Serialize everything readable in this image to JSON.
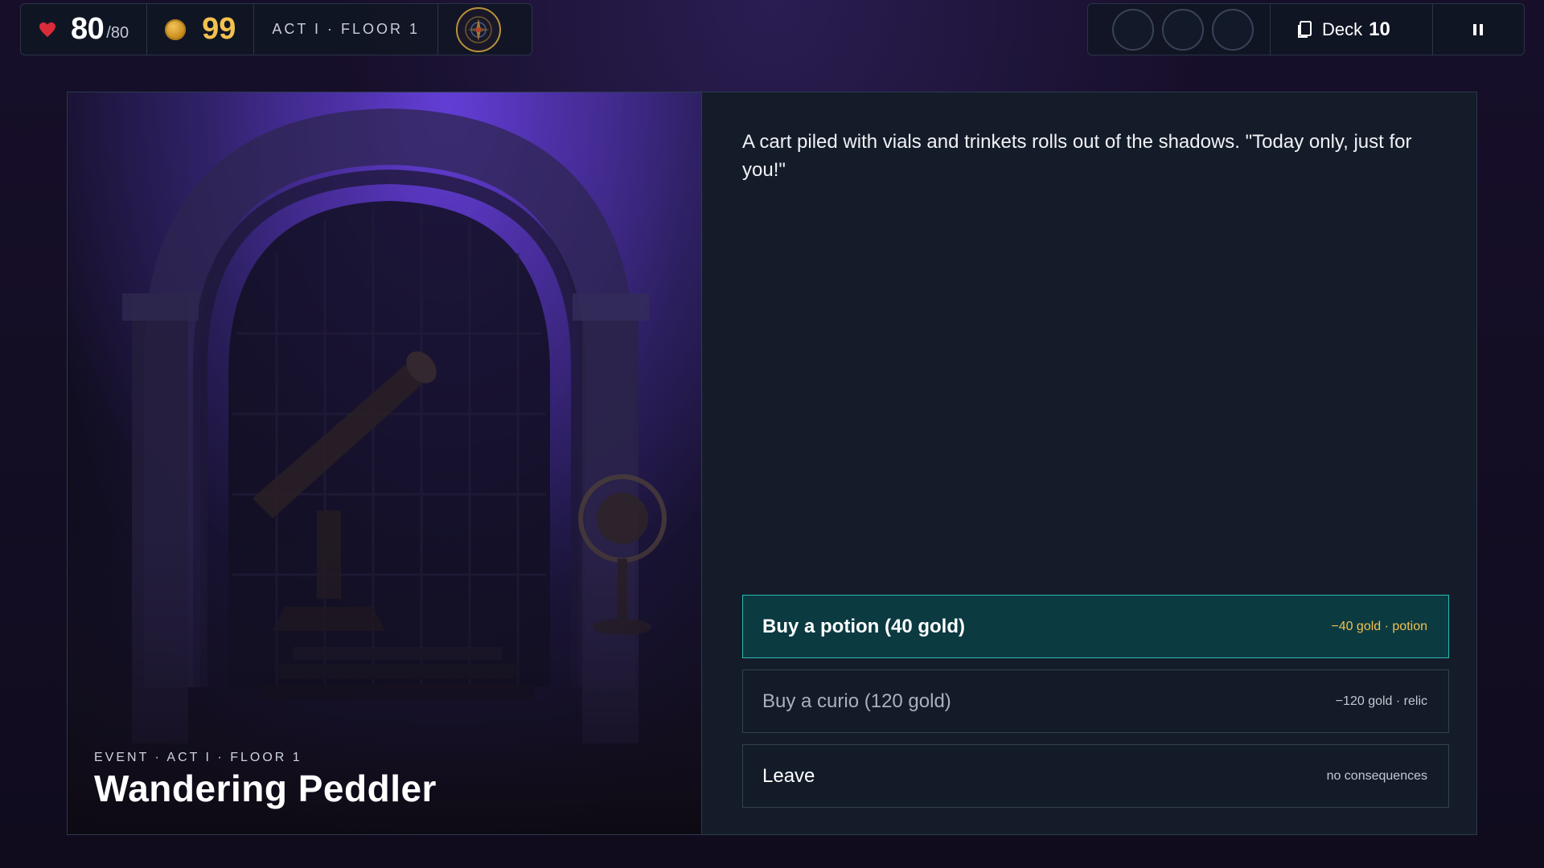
{
  "hud": {
    "hp_current": "80",
    "hp_max": "/80",
    "gold": "99",
    "location": "ACT I · FLOOR 1",
    "deck_label": "Deck",
    "deck_count": "10",
    "relic_slots": 3,
    "colors": {
      "hp": "#d92b3a",
      "gold": "#f2c14e",
      "accent": "#2fb9b2"
    }
  },
  "event": {
    "tag": "EVENT · ACT I · FLOOR 1",
    "title": "Wandering Peddler",
    "description": "A cart piled with vials and trinkets rolls out of the shadows. \"Today only, just for you!\"",
    "choices": [
      {
        "label": "Buy a potion (40 gold)",
        "effect": "−40 gold · potion",
        "selected": true
      },
      {
        "label": "Buy a curio (120 gold)",
        "effect": "−120 gold · relic",
        "selected": false
      },
      {
        "label": "Leave",
        "effect": "no consequences",
        "selected": false
      }
    ]
  },
  "icons": {
    "hp": "heart-icon",
    "gold": "coin-icon",
    "map": "compass-icon",
    "deck": "cards-icon",
    "pause": "pause-icon"
  }
}
